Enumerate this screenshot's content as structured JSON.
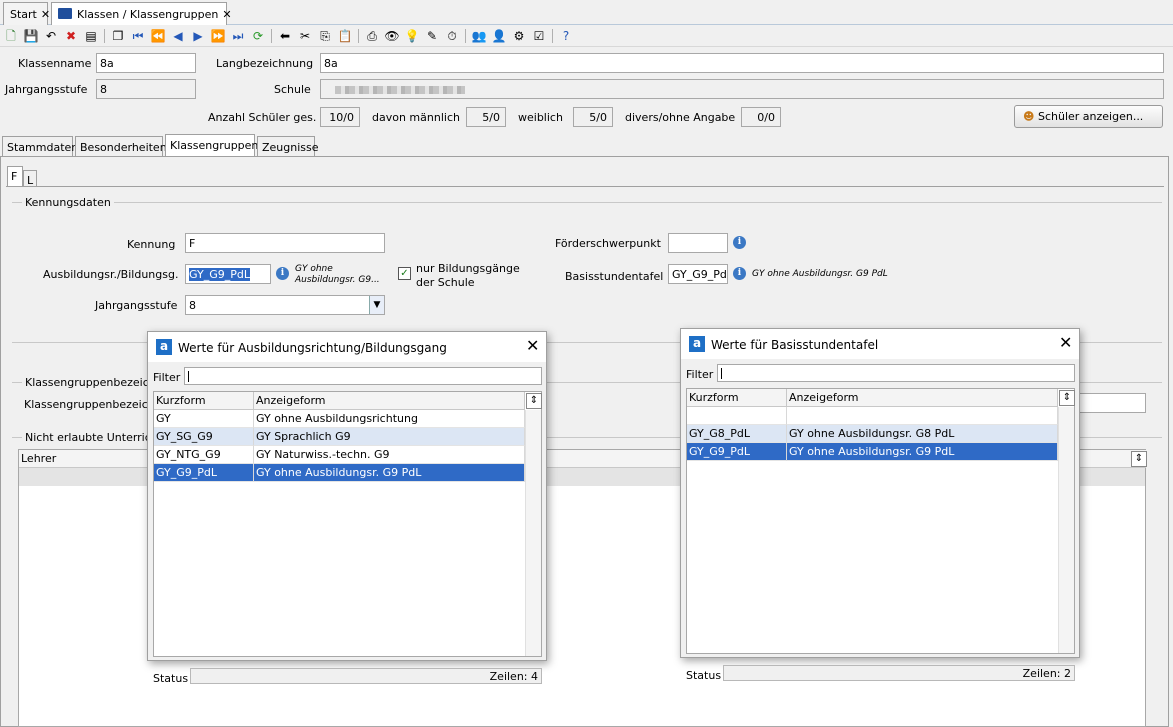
{
  "tabs": [
    {
      "label": "Start",
      "close": "✕"
    },
    {
      "label": "Klassen / Klassengruppen",
      "close": "✕"
    }
  ],
  "toolbar_icons": [
    "new-icon",
    "save-icon",
    "undo-icon",
    "delete-icon",
    "details-icon",
    "copy-record-icon",
    "first-icon",
    "prev-page-icon",
    "prev-icon",
    "next-icon",
    "next-page-icon",
    "last-icon",
    "refresh-icon",
    "back-icon",
    "cut-icon",
    "copy-icon",
    "paste-icon",
    "print-icon",
    "preview-icon",
    "idea-icon",
    "clean-icon",
    "clock-icon",
    "users-icon",
    "users-edit-icon",
    "settings-icon",
    "checklist-icon",
    "help-icon"
  ],
  "header": {
    "klassenname_label": "Klassenname",
    "klassenname_value": "8a",
    "langbezeichnung_label": "Langbezeichnung",
    "langbezeichnung_value": "8a",
    "jahrgangsstufe_label": "Jahrgangsstufe",
    "jahrgangsstufe_value": "8",
    "schule_label": "Schule",
    "anzahl_label": "Anzahl Schüler ges.",
    "anzahl_value": "10/0",
    "maennlich_label": "davon männlich",
    "maennlich_value": "5/0",
    "weiblich_label": "weiblich",
    "weiblich_value": "5/0",
    "divers_label": "divers/ohne Angabe",
    "divers_value": "0/0",
    "schueler_button": "Schüler anzeigen..."
  },
  "page_tabs": [
    "Stammdaten",
    "Besonderheiten",
    "Klassengruppen",
    "Zeugnisse"
  ],
  "sub_tabs": [
    "F",
    "L"
  ],
  "kennung": {
    "group_title": "Kennungsdaten",
    "kennung_label": "Kennung",
    "kennung_value": "F",
    "ausbildung_label": "Ausbildungsr./Bildungsg.",
    "ausbildung_value": "GY_G9_PdL",
    "ausbildung_desc_1": "GY ohne",
    "ausbildung_desc_2": "Ausbildungsr. G9...",
    "nur_label_1": "nur Bildungsgänge",
    "nur_label_2": "der Schule",
    "jahrgangsstufe_label": "Jahrgangsstufe",
    "jahrgangsstufe_value": "8",
    "foerder_label": "Förderschwerpunkt",
    "foerder_value": "",
    "basis_label": "Basisstundentafel",
    "basis_value": "GY_G9_PdL",
    "basis_desc": "GY ohne Ausbildungsr. G9 PdL"
  },
  "lower": {
    "gruppe_title": "Klassengruppenbezeich",
    "gruppe_label": "Klassengruppenbezeich",
    "nicht_title": "Nicht erlaubte Unterrich",
    "lehrer_header": "Lehrer"
  },
  "dialog1": {
    "title": "Werte für Ausbildungsrichtung/Bildungsgang",
    "filter_label": "Filter",
    "columns": [
      "Kurzform",
      "Anzeigeform"
    ],
    "rows": [
      [
        "GY",
        "GY ohne Ausbildungsrichtung"
      ],
      [
        "GY_SG_G9",
        "GY Sprachlich G9"
      ],
      [
        "GY_NTG_G9",
        "GY Naturwiss.-techn. G9"
      ],
      [
        "GY_G9_PdL",
        "GY ohne Ausbildungsr. G9 PdL"
      ]
    ],
    "status_label": "Status",
    "zeilen": "Zeilen: 4"
  },
  "dialog2": {
    "title": "Werte für Basisstundentafel",
    "filter_label": "Filter",
    "columns": [
      "Kurzform",
      "Anzeigeform"
    ],
    "rows": [
      [
        "",
        ""
      ],
      [
        "GY_G8_PdL",
        "GY ohne Ausbildungsr. G8 PdL"
      ],
      [
        "GY_G9_PdL",
        "GY ohne Ausbildungsr. G9 PdL"
      ]
    ],
    "status_label": "Status",
    "zeilen": "Zeilen: 2"
  },
  "colors": {
    "selection": "#2f6ac6",
    "alt_row": "#dce6f4",
    "accent": "#1e6fc6"
  }
}
